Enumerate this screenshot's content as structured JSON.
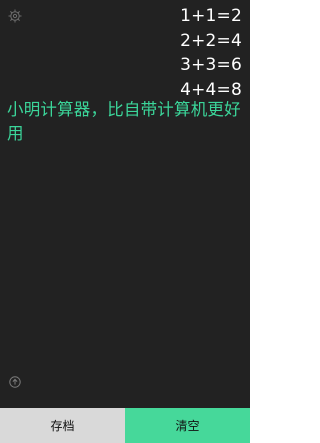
{
  "icons": {
    "settings": "gear-icon",
    "upload": "arrow-up-circle-icon"
  },
  "history": [
    "1+1=2",
    "2+2=4",
    "3+3=6",
    "4+4=8"
  ],
  "note": "小明计算器，比自带计算机更好用",
  "bottom_bar": {
    "save_label": "存档",
    "clear_label": "清空"
  },
  "colors": {
    "background": "#222222",
    "accent": "#46d89a",
    "note_text": "#3bd69a",
    "save_bg": "#d9d9d9"
  }
}
